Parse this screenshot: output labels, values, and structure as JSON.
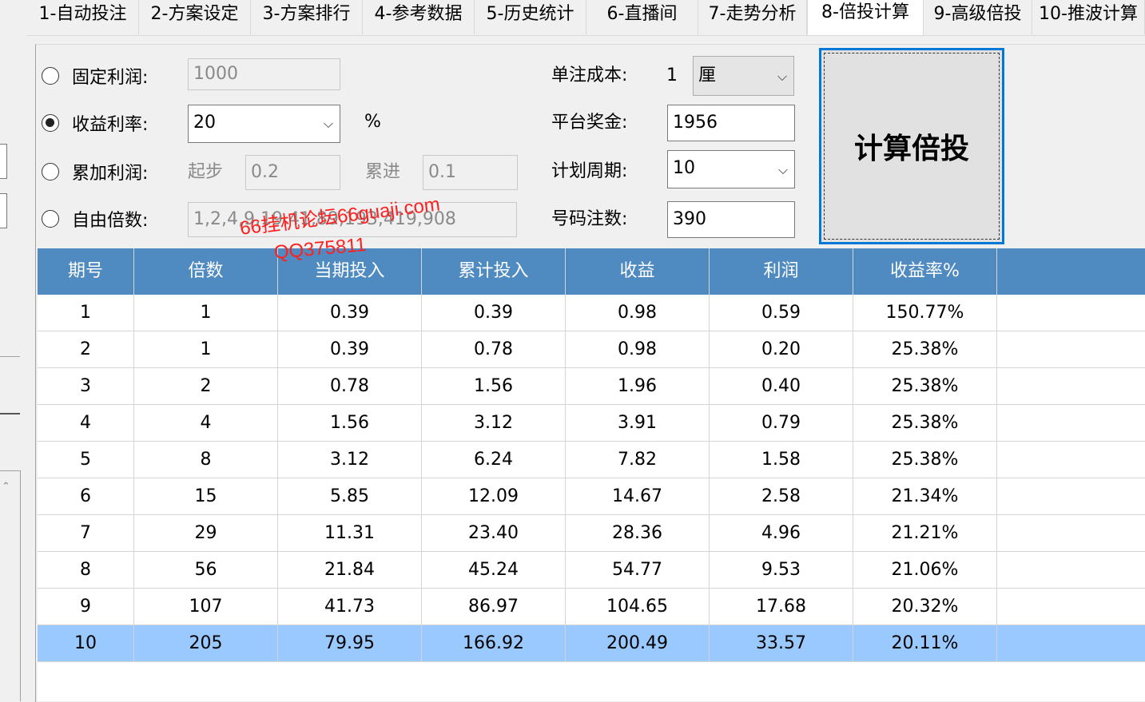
{
  "tabs": [
    {
      "label": "1-自动投注"
    },
    {
      "label": "2-方案设定"
    },
    {
      "label": "3-方案排行"
    },
    {
      "label": "4-参考数据"
    },
    {
      "label": "5-历史统计"
    },
    {
      "label": "6-直播间"
    },
    {
      "label": "7-走势分析"
    },
    {
      "label": "8-倍投计算"
    },
    {
      "label": "9-高级倍投"
    },
    {
      "label": "10-推波计算"
    }
  ],
  "active_tab": "8-倍投计算",
  "form": {
    "fixed_profit": {
      "label": "固定利润:",
      "value": "1000",
      "checked": false
    },
    "yield_rate": {
      "label": "收益利率:",
      "value": "20",
      "unit": "%",
      "checked": true
    },
    "cumulative_profit": {
      "label": "累加利润:",
      "start_label": "起步",
      "start_value": "0.2",
      "step_label": "累进",
      "step_value": "0.1",
      "checked": false
    },
    "free_multiplier": {
      "label": "自由倍数:",
      "value": "1,2,4,9,19,41,89,193,419,908",
      "checked": false
    },
    "unit_cost": {
      "label": "单注成本:",
      "value": "1",
      "unit": "厘"
    },
    "platform_prize": {
      "label": "平台奖金:",
      "value": "1956"
    },
    "plan_period": {
      "label": "计划周期:",
      "value": "10"
    },
    "bet_count": {
      "label": "号码注数:",
      "value": "390"
    },
    "calc_button": "计算倍投"
  },
  "watermark": {
    "line1": "66挂机论坛66guaji.com",
    "line2": "QQ375811"
  },
  "table": {
    "columns": [
      "期号",
      "倍数",
      "当期投入",
      "累计投入",
      "收益",
      "利润",
      "收益率%"
    ],
    "rows": [
      [
        "1",
        "1",
        "0.39",
        "0.39",
        "0.98",
        "0.59",
        "150.77%"
      ],
      [
        "2",
        "1",
        "0.39",
        "0.78",
        "0.98",
        "0.20",
        "25.38%"
      ],
      [
        "3",
        "2",
        "0.78",
        "1.56",
        "1.96",
        "0.40",
        "25.38%"
      ],
      [
        "4",
        "4",
        "1.56",
        "3.12",
        "3.91",
        "0.79",
        "25.38%"
      ],
      [
        "5",
        "8",
        "3.12",
        "6.24",
        "7.82",
        "1.58",
        "25.38%"
      ],
      [
        "6",
        "15",
        "5.85",
        "12.09",
        "14.67",
        "2.58",
        "21.34%"
      ],
      [
        "7",
        "29",
        "11.31",
        "23.40",
        "28.36",
        "4.96",
        "21.21%"
      ],
      [
        "8",
        "56",
        "21.84",
        "45.24",
        "54.77",
        "9.53",
        "21.06%"
      ],
      [
        "9",
        "107",
        "41.73",
        "86.97",
        "104.65",
        "17.68",
        "20.32%"
      ],
      [
        "10",
        "205",
        "79.95",
        "166.92",
        "200.49",
        "33.57",
        "20.11%"
      ]
    ],
    "selected_row": 10
  },
  "colors": {
    "header_bg": "#4f8ac1",
    "selected_row_bg": "#99c9ff",
    "watermark": "#ff2020",
    "focus_border": "#0078d7"
  }
}
